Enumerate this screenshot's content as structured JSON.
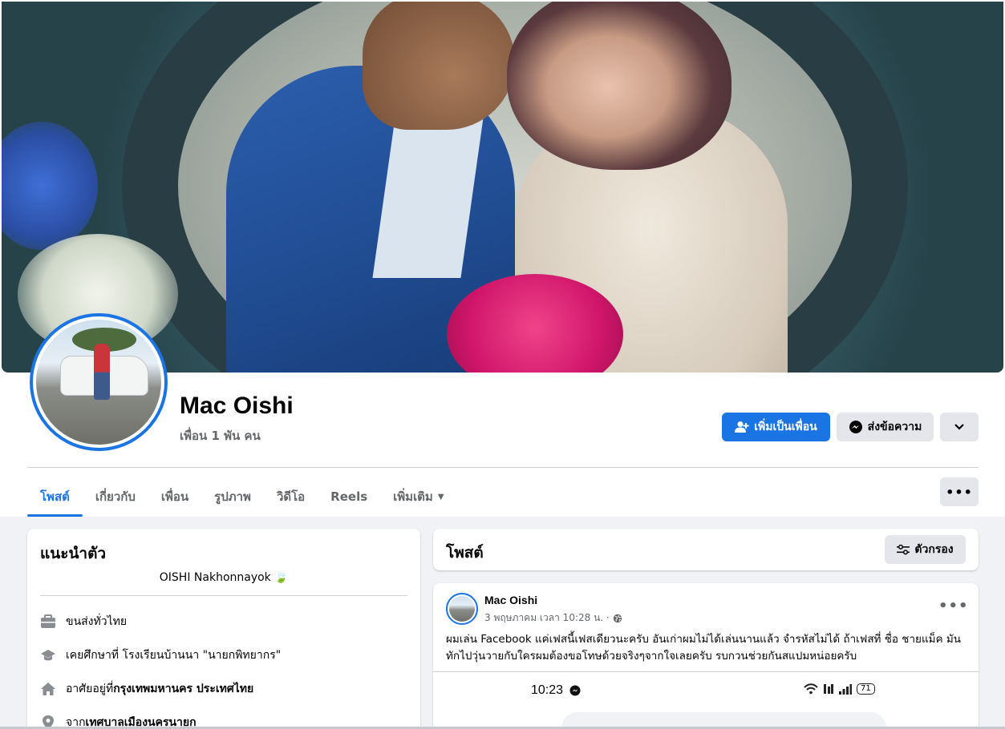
{
  "profile": {
    "name": "Mac Oishi",
    "friends_count": "เพื่อน 1 พัน คน"
  },
  "actions": {
    "add_friend": "เพิ่มเป็นเพื่อน",
    "message": "ส่งข้อความ"
  },
  "tabs": [
    {
      "label": "โพสต์",
      "active": true
    },
    {
      "label": "เกี่ยวกับ",
      "active": false
    },
    {
      "label": "เพื่อน",
      "active": false
    },
    {
      "label": "รูปภาพ",
      "active": false
    },
    {
      "label": "วิดีโอ",
      "active": false
    },
    {
      "label": "Reels",
      "active": false
    },
    {
      "label": "เพิ่มเติม",
      "active": false
    }
  ],
  "intro": {
    "title": "แนะนำตัว",
    "bio": "OISHI Nakhonnayok",
    "rows": [
      {
        "icon": "briefcase-icon",
        "text": "ขนส่งทั่วไทย",
        "bold": ""
      },
      {
        "icon": "graduation-cap-icon",
        "text": "เคยศึกษาที่ โรงเรียนบ้านนา \"นายกพิทยากร\"",
        "bold": ""
      },
      {
        "icon": "home-icon",
        "text": "อาศัยอยู่ที่ ",
        "bold": "กรุงเทพมหานคร ประเทศไทย"
      },
      {
        "icon": "location-pin-icon",
        "text": "จาก ",
        "bold": "เทศบาลเมืองนครนายก"
      }
    ]
  },
  "posts": {
    "title": "โพสต์",
    "filter_label": "ตัวกรอง"
  },
  "post": {
    "author": "Mac Oishi",
    "meta": "3 พฤษภาคม เวลา 10:28 น. ·",
    "text": "ผมเล่น Facebook แค่เฟสนี้เฟสเดียวนะครับ อันเก่าผมไม่ได้เล่นนานแล้ว จำรหัสไม่ได้ ถ้าเฟสที่ ชื่อ ชายแม็ค มันทักไปวุ่นวายกับใครผมต้องขอโทษด้วยจริงๆจากใจเลยครับ รบกวนช่วยกันสแปมหน่อยครับ",
    "screenshot_time": "10:23",
    "screenshot_battery": "71"
  },
  "colors": {
    "accent": "#1b74e4",
    "background": "#f0f2f5",
    "secondary_text": "#65676b"
  }
}
